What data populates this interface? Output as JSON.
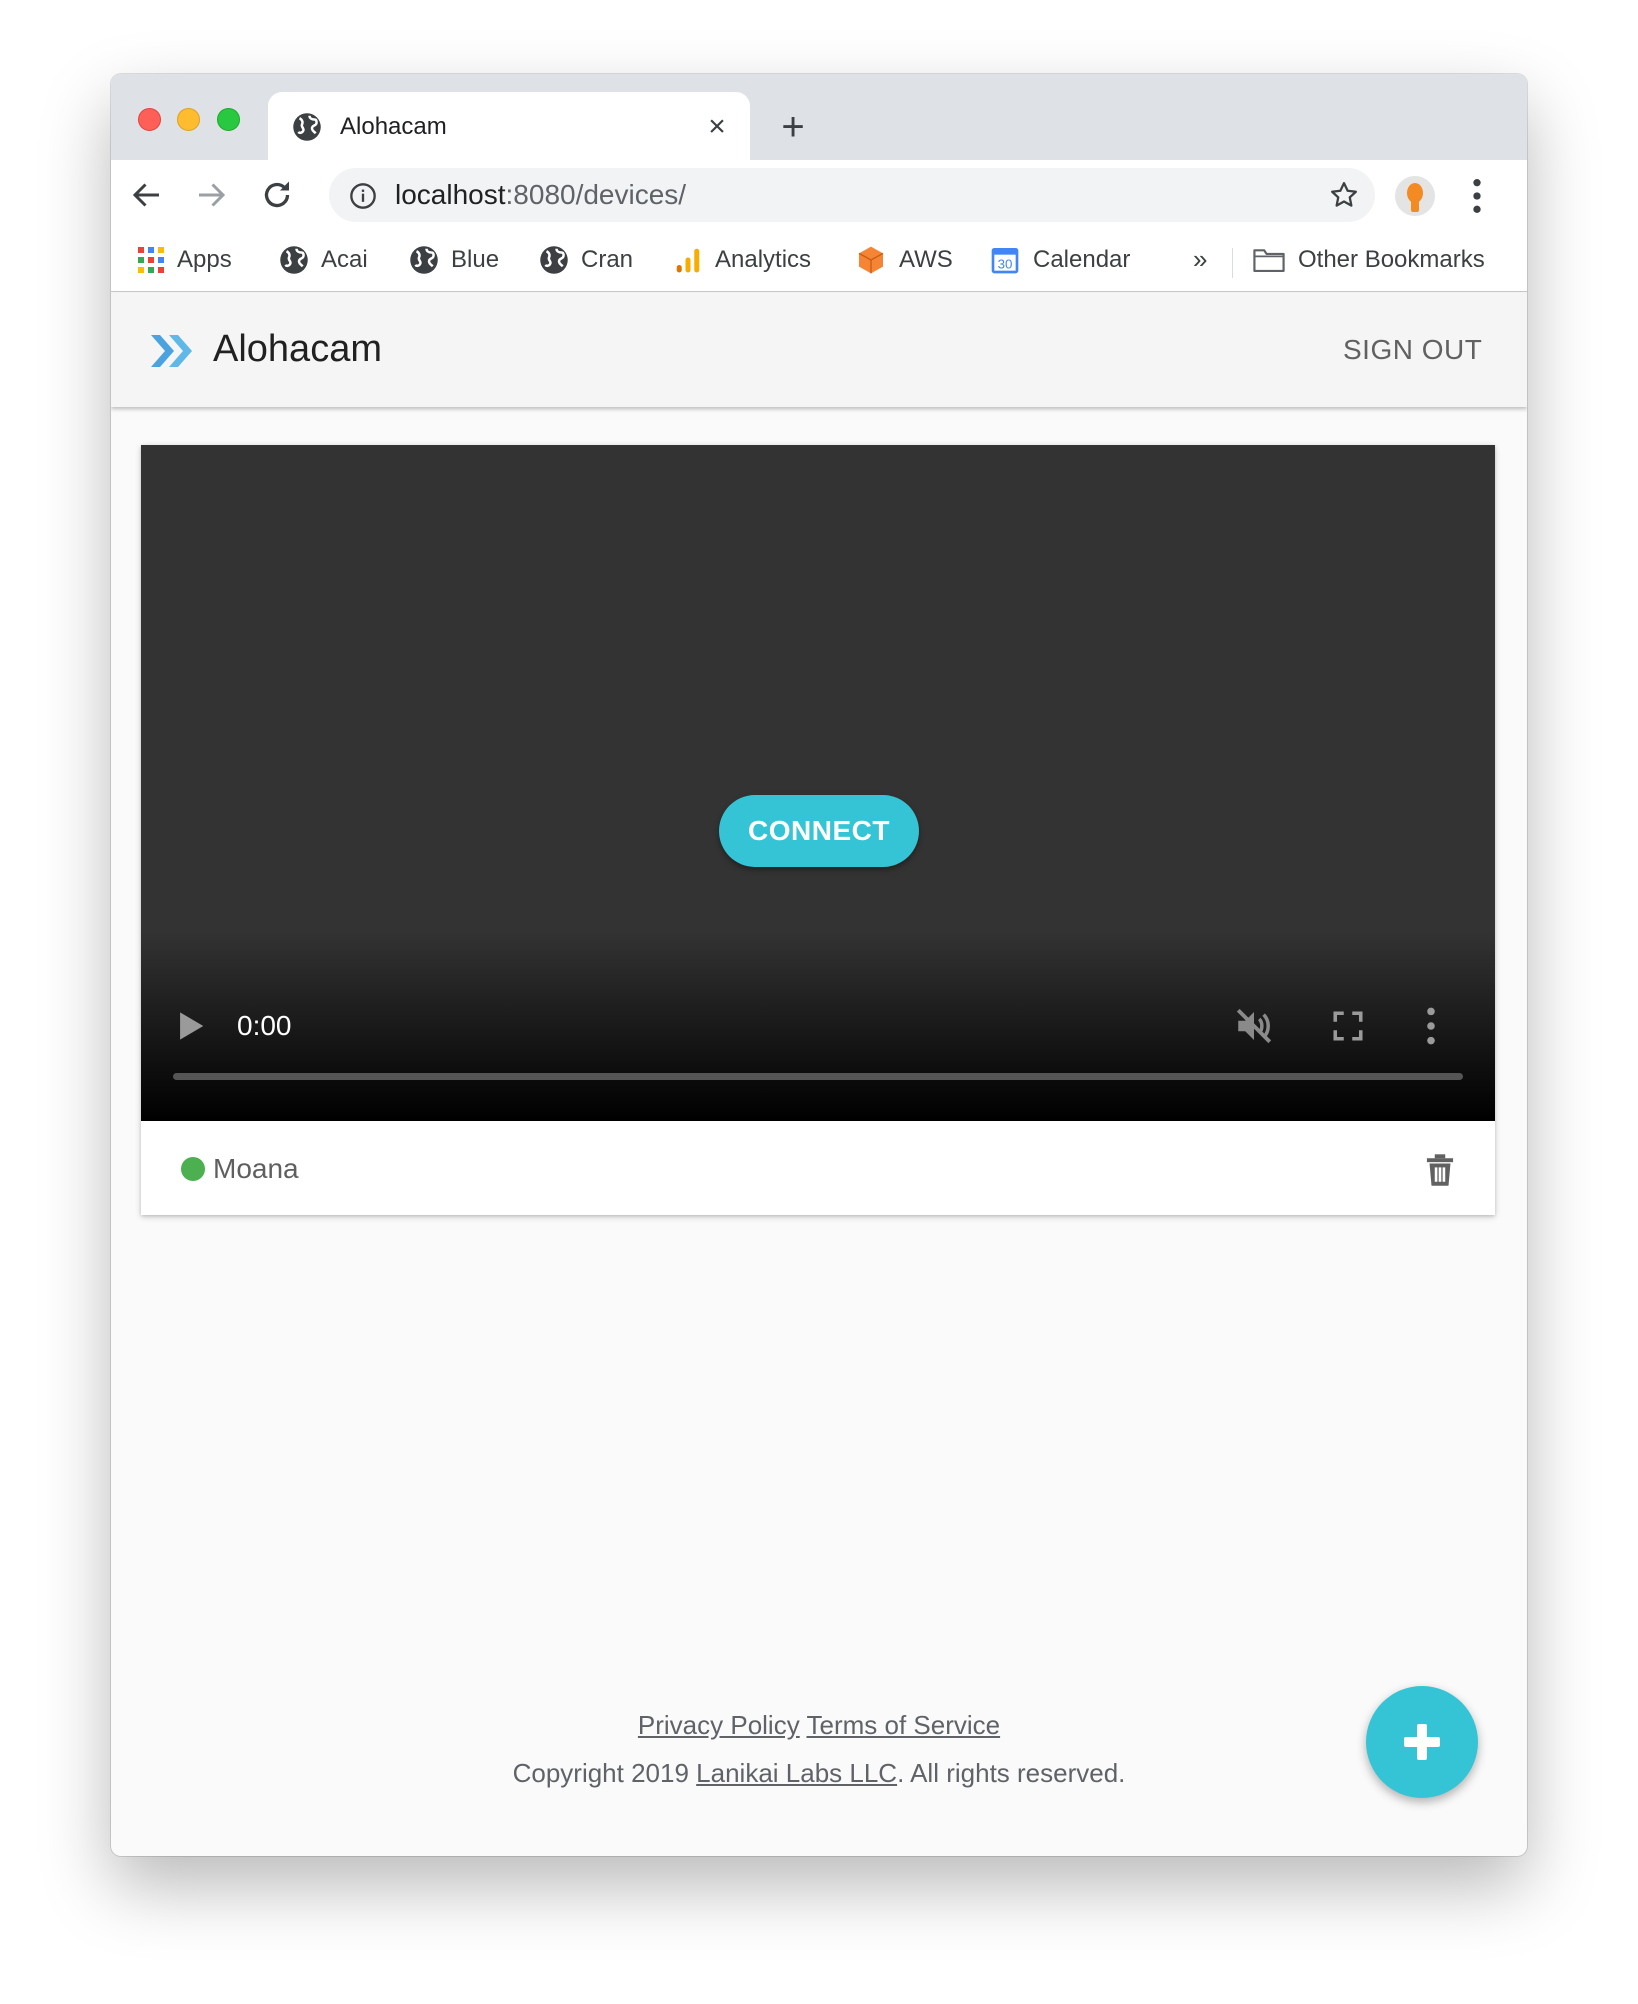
{
  "browser": {
    "tab_title": "Alohacam",
    "url_host": "localhost",
    "url_path": ":8080/devices/",
    "bookmarks": [
      {
        "label": "Apps",
        "icon": "apps-grid-icon"
      },
      {
        "label": "Acai",
        "icon": "globe-icon"
      },
      {
        "label": "Blue",
        "icon": "globe-icon"
      },
      {
        "label": "Cran",
        "icon": "globe-icon"
      },
      {
        "label": "Analytics",
        "icon": "analytics-icon"
      },
      {
        "label": "AWS",
        "icon": "aws-cube-icon"
      },
      {
        "label": "Calendar",
        "icon": "calendar-icon"
      }
    ],
    "more_bookmarks": "»",
    "other_bookmarks": "Other Bookmarks",
    "calendar_day": "30"
  },
  "app": {
    "brand": "Alohacam",
    "sign_out": "SIGN OUT"
  },
  "device": {
    "connect_label": "CONNECT",
    "time": "0:00",
    "name": "Moana",
    "status_color": "#4caf50",
    "progress": 0
  },
  "footer": {
    "privacy": "Privacy Policy",
    "terms": "Terms of Service",
    "copyright_prefix": "Copyright 2019 ",
    "company": "Lanikai Labs LLC",
    "copyright_suffix": ". All rights reserved."
  },
  "colors": {
    "accent": "#35c4d6",
    "logo": "#4aa3df"
  }
}
